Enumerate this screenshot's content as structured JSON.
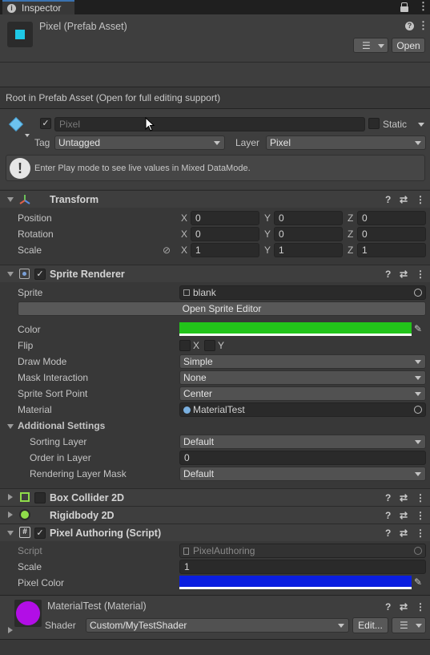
{
  "tab": {
    "title": "Inspector"
  },
  "asset": {
    "name": "Pixel (Prefab Asset)",
    "open_label": "Open"
  },
  "root_notice": "Root in Prefab Asset (Open for full editing support)",
  "gameobject": {
    "name": "Pixel",
    "static_label": "Static",
    "tag_label": "Tag",
    "tag_value": "Untagged",
    "layer_label": "Layer",
    "layer_value": "Pixel"
  },
  "info": "Enter Play mode to see live values in Mixed DataMode.",
  "transform": {
    "title": "Transform",
    "rows": [
      {
        "label": "Position",
        "x": "0",
        "y": "0",
        "z": "0"
      },
      {
        "label": "Rotation",
        "x": "0",
        "y": "0",
        "z": "0"
      },
      {
        "label": "Scale",
        "x": "1",
        "y": "1",
        "z": "1"
      }
    ],
    "axis": {
      "x": "X",
      "y": "Y",
      "z": "Z"
    }
  },
  "sprite_renderer": {
    "title": "Sprite Renderer",
    "sprite_label": "Sprite",
    "sprite_value": "blank",
    "open_editor": "Open Sprite Editor",
    "color_label": "Color",
    "color_value": "#22c41a",
    "flip_label": "Flip",
    "flip_x": "X",
    "flip_y": "Y",
    "draw_mode_label": "Draw Mode",
    "draw_mode_value": "Simple",
    "mask_label": "Mask Interaction",
    "mask_value": "None",
    "sort_point_label": "Sprite Sort Point",
    "sort_point_value": "Center",
    "material_label": "Material",
    "material_value": "MaterialTest",
    "additional_label": "Additional Settings",
    "sorting_layer_label": "Sorting Layer",
    "sorting_layer_value": "Default",
    "order_label": "Order in Layer",
    "order_value": "0",
    "rendering_mask_label": "Rendering Layer Mask",
    "rendering_mask_value": "Default"
  },
  "box_collider": {
    "title": "Box Collider 2D"
  },
  "rigidbody": {
    "title": "Rigidbody 2D"
  },
  "pixel_authoring": {
    "title": "Pixel Authoring (Script)",
    "script_label": "Script",
    "script_value": "PixelAuthoring",
    "scale_label": "Scale",
    "scale_value": "1",
    "pixel_color_label": "Pixel Color",
    "pixel_color_value": "#0a1ee0"
  },
  "material": {
    "title": "MaterialTest (Material)",
    "shader_label": "Shader",
    "shader_value": "Custom/MyTestShader",
    "edit_label": "Edit...",
    "swatch_color": "#b20ee6"
  },
  "colors": {
    "accent_cyan": "#1ec8e6",
    "toolbar": "#282828",
    "panel": "#383838"
  }
}
